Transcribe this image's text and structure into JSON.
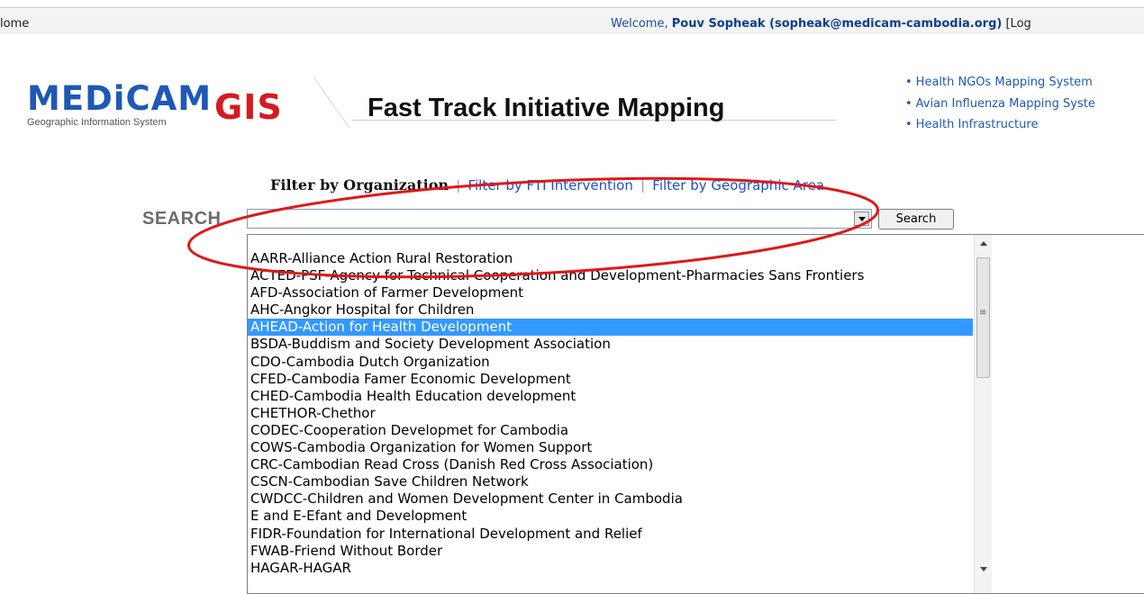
{
  "topbar": {
    "home_label": "lome",
    "welcome_prefix": "Welcome, ",
    "user_name": "Pouv Sopheak (sopheak@medicam-cambodia.org)",
    "welcome_suffix": "[Log"
  },
  "brand": {
    "name": "MEDiCAM",
    "gis": "GIS",
    "subtitle": "Geographic Information System",
    "page_title": "Fast Track Initiative Mapping",
    "colors": {
      "brand_blue": "#1f58b5",
      "brand_red": "#d71921"
    }
  },
  "side_links": [
    "Health NGOs Mapping System",
    "Avian Influenza Mapping Syste",
    "Health Infrastructure"
  ],
  "filters": {
    "active": "Filter by Organization",
    "separator": "|",
    "link_1": "Filter by FTI Intervention",
    "link_2": "Filter by Geographic Area"
  },
  "search": {
    "label": "SEARCH",
    "value": "",
    "button_label": "Search"
  },
  "dropdown": {
    "selected_index": 4,
    "options": [
      "AARR-Alliance Action Rural Restoration",
      "ACTED-PSF-Agency for Technical Cooperation and Development-Pharmacies Sans Frontiers",
      "AFD-Association of Farmer Development",
      "AHC-Angkor Hospital for Children",
      "AHEAD-Action for Health Development",
      "BSDA-Buddism and Society Development Association",
      "CDO-Cambodia Dutch Organization",
      "CFED-Cambodia Famer Economic Development",
      "CHED-Cambodia Health Education development",
      "CHETHOR-Chethor",
      "CODEC-Cooperation Developmet for Cambodia",
      "COWS-Cambodia Organization for Women Support",
      "CRC-Cambodian Read Cross (Danish Red Cross Association)",
      "CSCN-Cambodian Save Children Network",
      "CWDCC-Children and Women Development Center in Cambodia",
      "E and E-Efant and Development",
      "FIDR-Foundation for International Development and Relief",
      "FWAB-Friend Without Border",
      "HAGAR-HAGAR"
    ]
  },
  "annotation": {
    "color": "#e01818"
  }
}
